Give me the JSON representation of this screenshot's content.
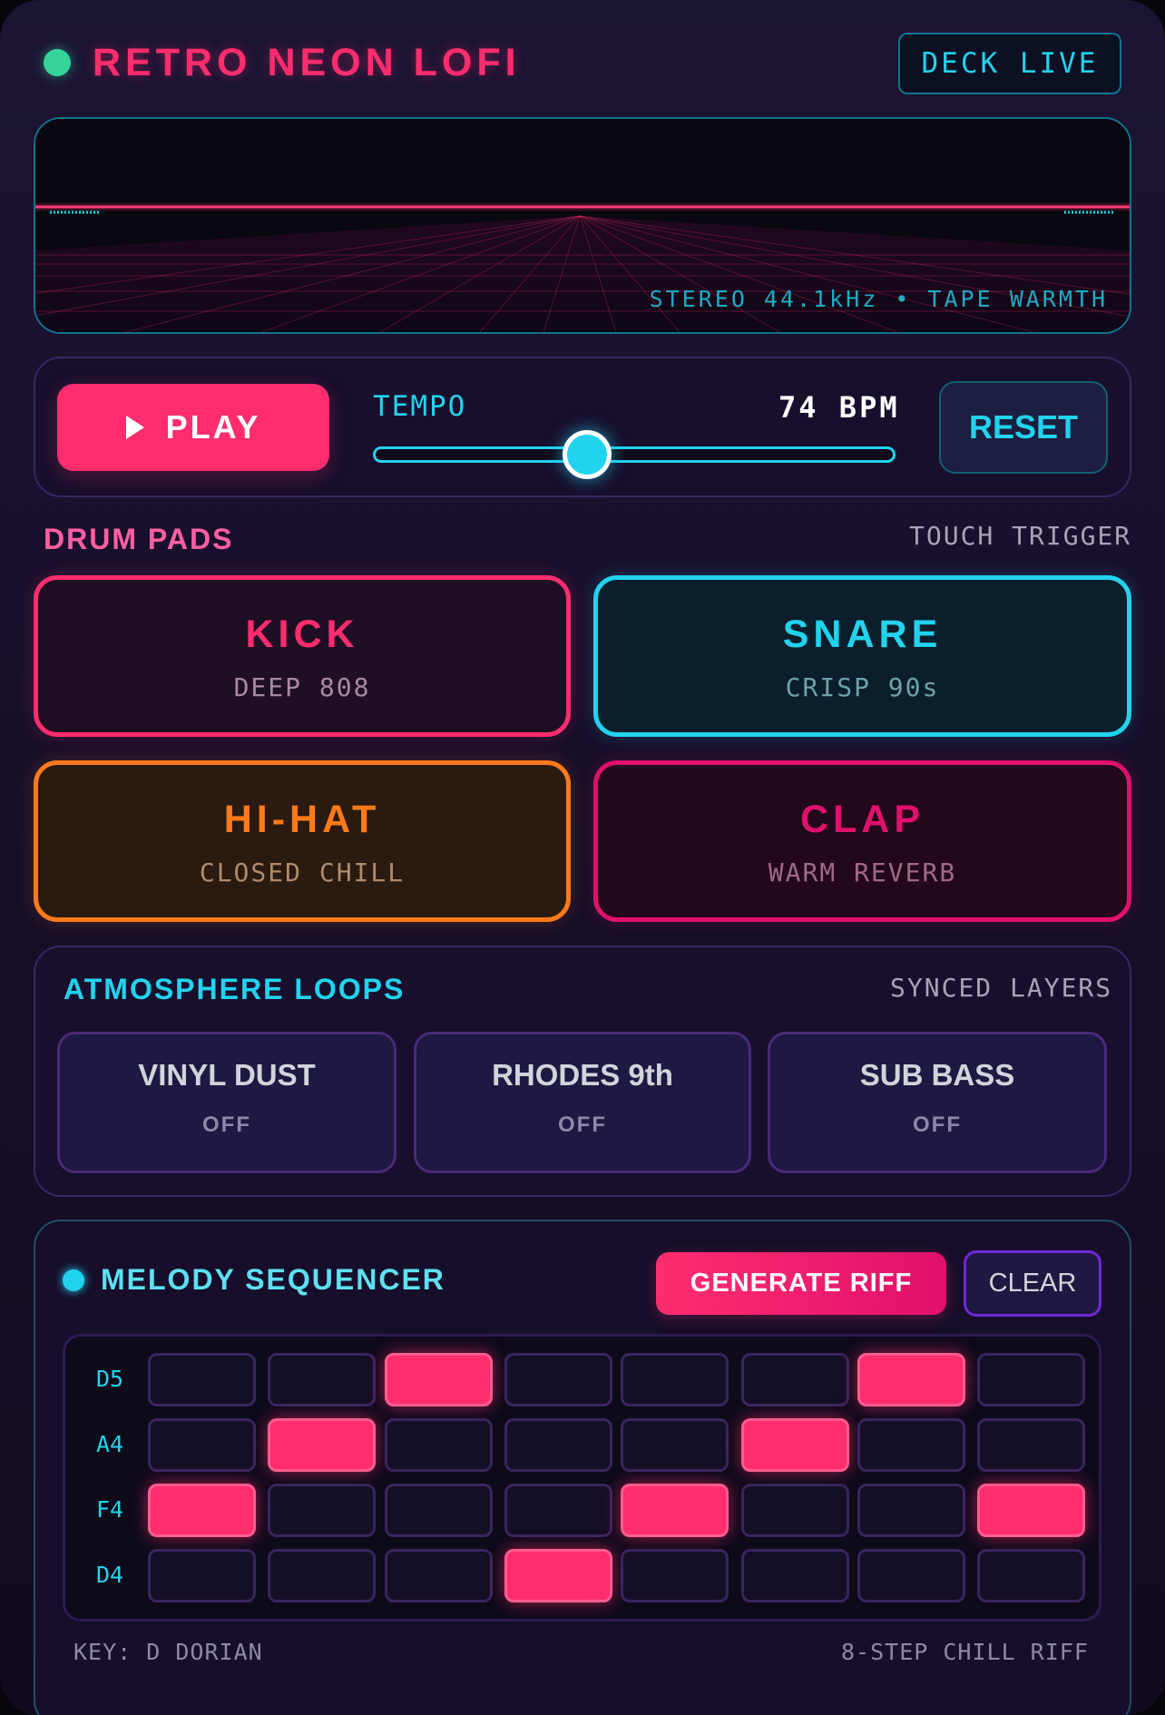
{
  "header": {
    "title": "RETRO NEON LOFI",
    "badge": "DECK LIVE"
  },
  "visualizer": {
    "caption": "STEREO 44.1kHz • TAPE WARMTH"
  },
  "transport": {
    "play_label": "PLAY",
    "tempo_label": "TEMPO",
    "tempo_value": "74 BPM",
    "tempo_position": 0.41,
    "reset_label": "RESET"
  },
  "drum_pads": {
    "title": "DRUM PADS",
    "hint": "TOUCH TRIGGER",
    "pads": [
      {
        "name": "KICK",
        "sub": "DEEP 808",
        "color": "#ff2d6e"
      },
      {
        "name": "SNARE",
        "sub": "CRISP 90s",
        "color": "#22d3ee"
      },
      {
        "name": "HI-HAT",
        "sub": "CLOSED CHILL",
        "color": "#ff7a1a"
      },
      {
        "name": "CLAP",
        "sub": "WARM REVERB",
        "color": "#e0106d"
      }
    ]
  },
  "atmosphere": {
    "title": "ATMOSPHERE LOOPS",
    "hint": "SYNCED LAYERS",
    "loops": [
      {
        "name": "VINYL DUST",
        "state": "OFF"
      },
      {
        "name": "RHODES 9th",
        "state": "OFF"
      },
      {
        "name": "SUB BASS",
        "state": "OFF"
      }
    ]
  },
  "sequencer": {
    "title": "MELODY SEQUENCER",
    "generate_label": "GENERATE RIFF",
    "clear_label": "CLEAR",
    "rows": [
      {
        "note": "D5",
        "steps": [
          0,
          0,
          1,
          0,
          0,
          0,
          1,
          0
        ]
      },
      {
        "note": "A4",
        "steps": [
          0,
          1,
          0,
          0,
          0,
          1,
          0,
          0
        ]
      },
      {
        "note": "F4",
        "steps": [
          1,
          0,
          0,
          0,
          1,
          0,
          0,
          1
        ]
      },
      {
        "note": "D4",
        "steps": [
          0,
          0,
          0,
          1,
          0,
          0,
          0,
          0
        ]
      }
    ],
    "footer_left": "KEY: D DORIAN",
    "footer_right": "8-STEP CHILL RIFF"
  },
  "colors": {
    "accent_pink": "#ff2d6e",
    "accent_cyan": "#22d3ee",
    "status_green": "#34d399"
  }
}
